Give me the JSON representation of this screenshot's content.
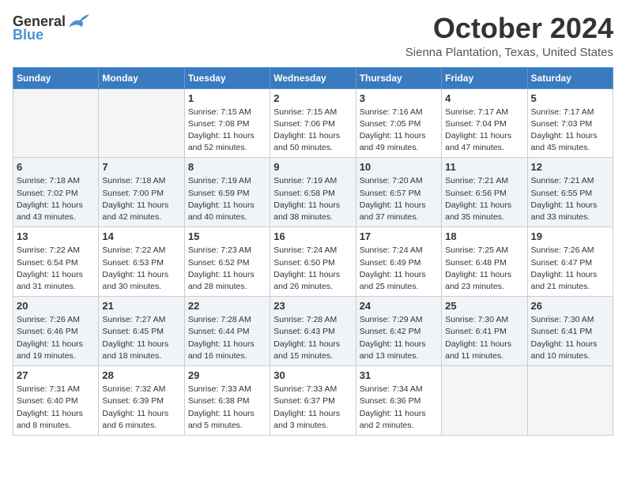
{
  "header": {
    "logo_general": "General",
    "logo_blue": "Blue",
    "month_title": "October 2024",
    "location": "Sienna Plantation, Texas, United States"
  },
  "days_of_week": [
    "Sunday",
    "Monday",
    "Tuesday",
    "Wednesday",
    "Thursday",
    "Friday",
    "Saturday"
  ],
  "weeks": [
    [
      null,
      null,
      {
        "day": 1,
        "sunrise": "Sunrise: 7:15 AM",
        "sunset": "Sunset: 7:08 PM",
        "daylight": "Daylight: 11 hours and 52 minutes."
      },
      {
        "day": 2,
        "sunrise": "Sunrise: 7:15 AM",
        "sunset": "Sunset: 7:06 PM",
        "daylight": "Daylight: 11 hours and 50 minutes."
      },
      {
        "day": 3,
        "sunrise": "Sunrise: 7:16 AM",
        "sunset": "Sunset: 7:05 PM",
        "daylight": "Daylight: 11 hours and 49 minutes."
      },
      {
        "day": 4,
        "sunrise": "Sunrise: 7:17 AM",
        "sunset": "Sunset: 7:04 PM",
        "daylight": "Daylight: 11 hours and 47 minutes."
      },
      {
        "day": 5,
        "sunrise": "Sunrise: 7:17 AM",
        "sunset": "Sunset: 7:03 PM",
        "daylight": "Daylight: 11 hours and 45 minutes."
      }
    ],
    [
      {
        "day": 6,
        "sunrise": "Sunrise: 7:18 AM",
        "sunset": "Sunset: 7:02 PM",
        "daylight": "Daylight: 11 hours and 43 minutes."
      },
      {
        "day": 7,
        "sunrise": "Sunrise: 7:18 AM",
        "sunset": "Sunset: 7:00 PM",
        "daylight": "Daylight: 11 hours and 42 minutes."
      },
      {
        "day": 8,
        "sunrise": "Sunrise: 7:19 AM",
        "sunset": "Sunset: 6:59 PM",
        "daylight": "Daylight: 11 hours and 40 minutes."
      },
      {
        "day": 9,
        "sunrise": "Sunrise: 7:19 AM",
        "sunset": "Sunset: 6:58 PM",
        "daylight": "Daylight: 11 hours and 38 minutes."
      },
      {
        "day": 10,
        "sunrise": "Sunrise: 7:20 AM",
        "sunset": "Sunset: 6:57 PM",
        "daylight": "Daylight: 11 hours and 37 minutes."
      },
      {
        "day": 11,
        "sunrise": "Sunrise: 7:21 AM",
        "sunset": "Sunset: 6:56 PM",
        "daylight": "Daylight: 11 hours and 35 minutes."
      },
      {
        "day": 12,
        "sunrise": "Sunrise: 7:21 AM",
        "sunset": "Sunset: 6:55 PM",
        "daylight": "Daylight: 11 hours and 33 minutes."
      }
    ],
    [
      {
        "day": 13,
        "sunrise": "Sunrise: 7:22 AM",
        "sunset": "Sunset: 6:54 PM",
        "daylight": "Daylight: 11 hours and 31 minutes."
      },
      {
        "day": 14,
        "sunrise": "Sunrise: 7:22 AM",
        "sunset": "Sunset: 6:53 PM",
        "daylight": "Daylight: 11 hours and 30 minutes."
      },
      {
        "day": 15,
        "sunrise": "Sunrise: 7:23 AM",
        "sunset": "Sunset: 6:52 PM",
        "daylight": "Daylight: 11 hours and 28 minutes."
      },
      {
        "day": 16,
        "sunrise": "Sunrise: 7:24 AM",
        "sunset": "Sunset: 6:50 PM",
        "daylight": "Daylight: 11 hours and 26 minutes."
      },
      {
        "day": 17,
        "sunrise": "Sunrise: 7:24 AM",
        "sunset": "Sunset: 6:49 PM",
        "daylight": "Daylight: 11 hours and 25 minutes."
      },
      {
        "day": 18,
        "sunrise": "Sunrise: 7:25 AM",
        "sunset": "Sunset: 6:48 PM",
        "daylight": "Daylight: 11 hours and 23 minutes."
      },
      {
        "day": 19,
        "sunrise": "Sunrise: 7:26 AM",
        "sunset": "Sunset: 6:47 PM",
        "daylight": "Daylight: 11 hours and 21 minutes."
      }
    ],
    [
      {
        "day": 20,
        "sunrise": "Sunrise: 7:26 AM",
        "sunset": "Sunset: 6:46 PM",
        "daylight": "Daylight: 11 hours and 19 minutes."
      },
      {
        "day": 21,
        "sunrise": "Sunrise: 7:27 AM",
        "sunset": "Sunset: 6:45 PM",
        "daylight": "Daylight: 11 hours and 18 minutes."
      },
      {
        "day": 22,
        "sunrise": "Sunrise: 7:28 AM",
        "sunset": "Sunset: 6:44 PM",
        "daylight": "Daylight: 11 hours and 16 minutes."
      },
      {
        "day": 23,
        "sunrise": "Sunrise: 7:28 AM",
        "sunset": "Sunset: 6:43 PM",
        "daylight": "Daylight: 11 hours and 15 minutes."
      },
      {
        "day": 24,
        "sunrise": "Sunrise: 7:29 AM",
        "sunset": "Sunset: 6:42 PM",
        "daylight": "Daylight: 11 hours and 13 minutes."
      },
      {
        "day": 25,
        "sunrise": "Sunrise: 7:30 AM",
        "sunset": "Sunset: 6:41 PM",
        "daylight": "Daylight: 11 hours and 11 minutes."
      },
      {
        "day": 26,
        "sunrise": "Sunrise: 7:30 AM",
        "sunset": "Sunset: 6:41 PM",
        "daylight": "Daylight: 11 hours and 10 minutes."
      }
    ],
    [
      {
        "day": 27,
        "sunrise": "Sunrise: 7:31 AM",
        "sunset": "Sunset: 6:40 PM",
        "daylight": "Daylight: 11 hours and 8 minutes."
      },
      {
        "day": 28,
        "sunrise": "Sunrise: 7:32 AM",
        "sunset": "Sunset: 6:39 PM",
        "daylight": "Daylight: 11 hours and 6 minutes."
      },
      {
        "day": 29,
        "sunrise": "Sunrise: 7:33 AM",
        "sunset": "Sunset: 6:38 PM",
        "daylight": "Daylight: 11 hours and 5 minutes."
      },
      {
        "day": 30,
        "sunrise": "Sunrise: 7:33 AM",
        "sunset": "Sunset: 6:37 PM",
        "daylight": "Daylight: 11 hours and 3 minutes."
      },
      {
        "day": 31,
        "sunrise": "Sunrise: 7:34 AM",
        "sunset": "Sunset: 6:36 PM",
        "daylight": "Daylight: 11 hours and 2 minutes."
      },
      null,
      null
    ]
  ]
}
